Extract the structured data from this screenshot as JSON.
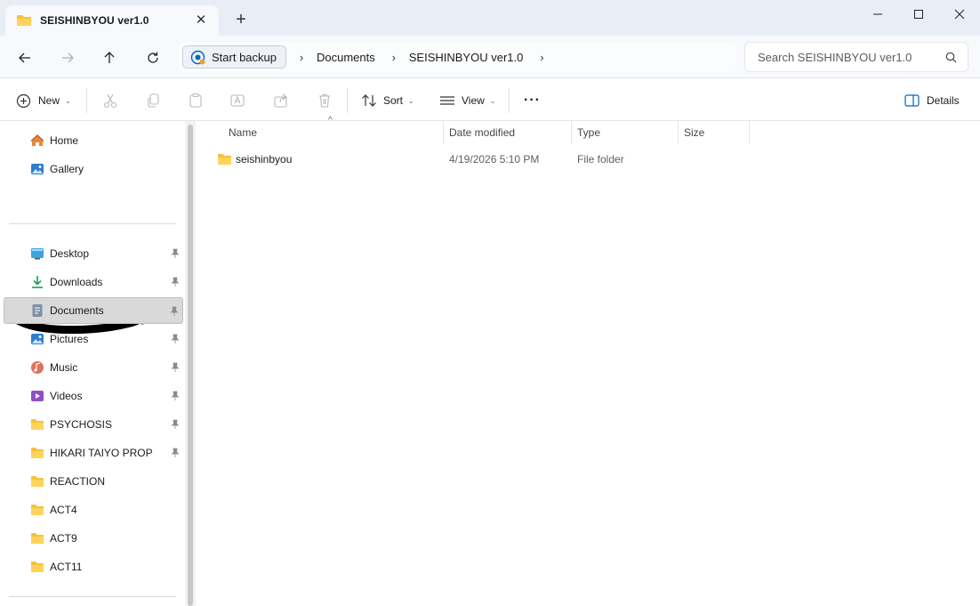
{
  "window": {
    "tab_title": "SEISHINBYOU ver1.0",
    "tab_close_glyph": "✕",
    "new_tab_glyph": "+"
  },
  "nav": {
    "backup_label": "Start backup",
    "breadcrumbs": [
      "Documents",
      "SEISHINBYOU ver1.0"
    ],
    "search_placeholder": "Search SEISHINBYOU ver1.0"
  },
  "toolbar": {
    "new_label": "New",
    "sort_label": "Sort",
    "view_label": "View",
    "more_label": "···",
    "details_label": "Details"
  },
  "sidebar": {
    "top_items": [
      {
        "label": "Home",
        "icon": "home-icon"
      },
      {
        "label": "Gallery",
        "icon": "gallery-icon"
      }
    ],
    "quick_access": [
      {
        "label": "Desktop",
        "icon": "desktop-icon",
        "pinned": true,
        "selected": false
      },
      {
        "label": "Downloads",
        "icon": "download-icon",
        "pinned": true,
        "selected": false
      },
      {
        "label": "Documents",
        "icon": "document-icon",
        "pinned": true,
        "selected": true
      },
      {
        "label": "Pictures",
        "icon": "picture-icon",
        "pinned": true,
        "selected": false
      },
      {
        "label": "Music",
        "icon": "music-icon",
        "pinned": true,
        "selected": false
      },
      {
        "label": "Videos",
        "icon": "video-icon",
        "pinned": true,
        "selected": false
      },
      {
        "label": "PSYCHOSIS",
        "icon": "folder-icon",
        "pinned": true,
        "selected": false
      },
      {
        "label": "HIKARI TAIYO PROP",
        "icon": "folder-icon",
        "pinned": true,
        "selected": false
      },
      {
        "label": "REACTION",
        "icon": "folder-icon",
        "pinned": false,
        "selected": false
      },
      {
        "label": "ACT4",
        "icon": "folder-icon",
        "pinned": false,
        "selected": false
      },
      {
        "label": "ACT9",
        "icon": "folder-icon",
        "pinned": false,
        "selected": false
      },
      {
        "label": "ACT11",
        "icon": "folder-icon",
        "pinned": false,
        "selected": false
      }
    ]
  },
  "file_list": {
    "columns": [
      "Name",
      "Date modified",
      "Type",
      "Size"
    ],
    "sort_indicator": "^",
    "rows": [
      {
        "name": "seishinbyou",
        "date": "4/19/2026 5:10 PM",
        "type": "File folder",
        "size": ""
      }
    ]
  },
  "colors": {
    "accent": "#0067c0",
    "folder": "#f8c13a",
    "selected": "#d9d9d9"
  }
}
